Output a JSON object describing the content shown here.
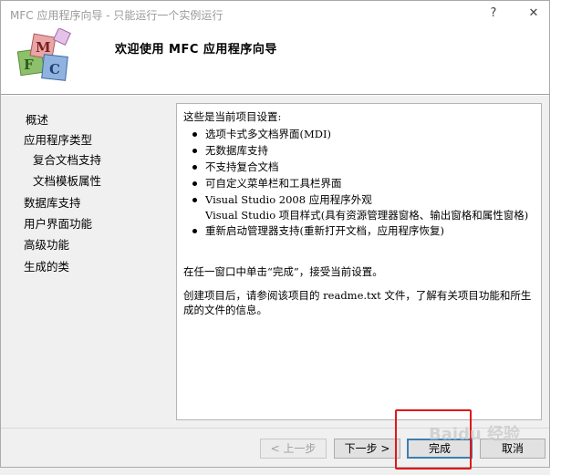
{
  "window": {
    "title": "MFC 应用程序向导 - 只能运行一个实例运行",
    "help_glyph": "?",
    "close_glyph": "✕"
  },
  "header": {
    "welcome": "欢迎使用 MFC 应用程序向导",
    "logo_letters": [
      "M",
      "F",
      "C"
    ]
  },
  "sidebar": {
    "items": [
      "概述",
      "应用程序类型",
      "复合文档支持",
      "文档模板属性",
      "数据库支持",
      "用户界面功能",
      "高级功能",
      "生成的类"
    ]
  },
  "content": {
    "intro": "这些是当前项目设置:",
    "bullets": [
      "选项卡式多文档界面(MDI)",
      "无数据库支持",
      "不支持复合文档",
      "可自定义菜单栏和工具栏界面",
      "Visual Studio 2008 应用程序外观",
      "Visual Studio 项目样式(具有资源管理器窗格、输出窗格和属性窗格)",
      "重新启动管理器支持(重新打开文档，应用程序恢复)"
    ],
    "finish_hint": "在任一窗口中单击“完成”，接受当前设置。",
    "readme_hint": "创建项目后，请参阅该项目的 readme.txt 文件，了解有关项目功能和所生成的文件的信息。"
  },
  "buttons": {
    "prev": "< 上一步",
    "next": "下一步 >",
    "finish": "完成",
    "cancel": "取消"
  },
  "watermark": "Baidu 经验",
  "colors": {
    "highlight_box": "#e01818",
    "default_button_border": "#3c7fb1"
  }
}
